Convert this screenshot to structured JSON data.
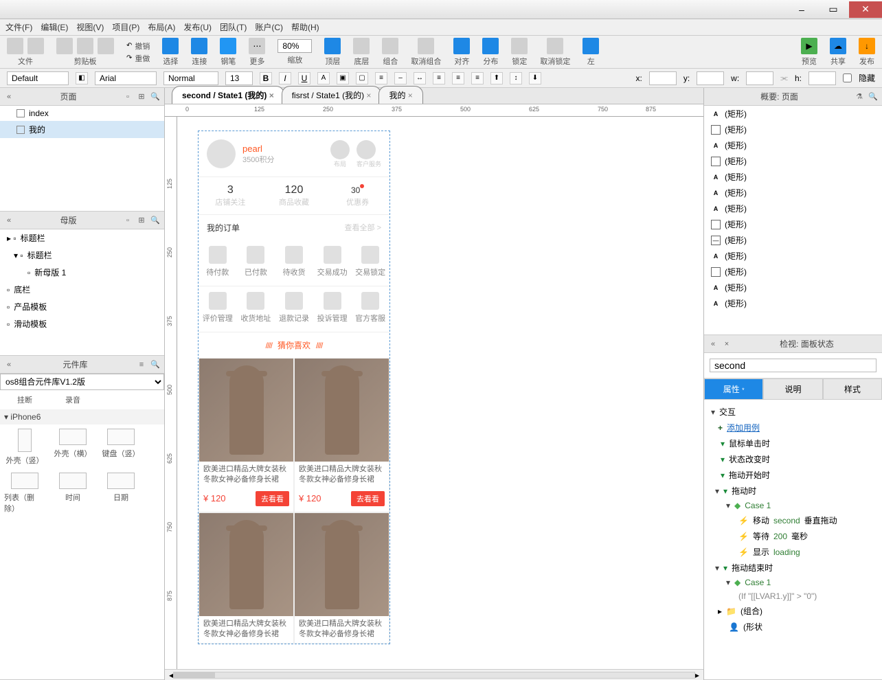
{
  "window": {
    "close": "✕",
    "max": "▭",
    "min": "–"
  },
  "menubar": [
    "文件(F)",
    "编辑(E)",
    "视图(V)",
    "项目(P)",
    "布局(A)",
    "发布(U)",
    "团队(T)",
    "账户(C)",
    "帮助(H)"
  ],
  "toolbar": {
    "file": "文件",
    "clipboard": "剪贴板",
    "undo": "撤销",
    "redo": "重做",
    "select": "选择",
    "connect": "连接",
    "pen": "钢笔",
    "more": "更多",
    "zoom_label": "缩放",
    "zoom": "80%",
    "front": "顶层",
    "back": "底层",
    "group": "组合",
    "ungroup": "取消组合",
    "align": "对齐",
    "distribute": "分布",
    "lock": "锁定",
    "unlock": "取消锁定",
    "left": "左",
    "preview": "预览",
    "share": "共享",
    "publish": "发布"
  },
  "formatbar": {
    "style": "Default",
    "font": "Arial",
    "weight": "Normal",
    "size": "13",
    "x": "x:",
    "y": "y:",
    "w": "w:",
    "h": "h:",
    "hidden": "隐藏"
  },
  "tabs": [
    {
      "label": "second / State1 (我的)",
      "active": true
    },
    {
      "label": "fisrst / State1 (我的)",
      "active": false
    },
    {
      "label": "我的",
      "active": false
    }
  ],
  "ruler_h": [
    "0",
    "125",
    "250",
    "375",
    "500",
    "625",
    "750",
    "875"
  ],
  "ruler_v": [
    "125",
    "250",
    "375",
    "500",
    "625",
    "750",
    "875"
  ],
  "pages_panel": {
    "title": "页面",
    "items": [
      {
        "label": "index",
        "sel": false
      },
      {
        "label": "我的",
        "sel": true
      }
    ]
  },
  "masters_panel": {
    "title": "母版",
    "items": [
      "标题栏",
      "标题栏",
      "新母版 1",
      "底栏",
      "产品模板",
      "滑动模板"
    ]
  },
  "widgets_panel": {
    "title": "元件库",
    "lib": "os8组合元件库V1.2版",
    "row1": [
      "挂断",
      "录音"
    ],
    "section": "iPhone6",
    "grid": [
      "外壳（竖）",
      "外壳（横）",
      "键盘（竖）",
      "列表（删除）",
      "时间",
      "日期"
    ]
  },
  "outline_panel": {
    "title": "概要: 页面",
    "items": [
      {
        "t": "A",
        "l": "(矩形)"
      },
      {
        "t": "box",
        "l": "(矩形)"
      },
      {
        "t": "A",
        "l": "(矩形)"
      },
      {
        "t": "box",
        "l": "(矩形)"
      },
      {
        "t": "A",
        "l": "(矩形)"
      },
      {
        "t": "A",
        "l": "(矩形)"
      },
      {
        "t": "A",
        "l": "(矩形)"
      },
      {
        "t": "box",
        "l": "(矩形)"
      },
      {
        "t": "line",
        "l": "(矩形)"
      },
      {
        "t": "A",
        "l": "(矩形)"
      },
      {
        "t": "box",
        "l": "(矩形)"
      },
      {
        "t": "A",
        "l": "(矩形)"
      },
      {
        "t": "A",
        "l": "(矩形)"
      }
    ]
  },
  "inspector": {
    "title": "检视: 面板状态",
    "name": "second",
    "tabs": [
      "属性",
      "说明",
      "样式"
    ],
    "interact": "交互",
    "add_case": "添加用例",
    "events": [
      "鼠标单击时",
      "状态改变时",
      "拖动开始时"
    ],
    "drag": "拖动时",
    "case1": "Case 1",
    "actions": [
      {
        "p": "移动 ",
        "g": "second",
        "s": " 垂直拖动"
      },
      {
        "p": "等待 ",
        "g": "200",
        "s": " 毫秒"
      },
      {
        "p": "显示 ",
        "g": "loading",
        "s": ""
      }
    ],
    "drag_end": "拖动结束时",
    "case1b": "Case 1",
    "cond": "(If \"[[LVAR1.y]]\" > \"0\")",
    "group": "(组合)",
    "shape": "(形状"
  },
  "mock": {
    "user": "pearl",
    "points": "3500积分",
    "msg": "布局",
    "svc": "客户服务",
    "stats": [
      {
        "n": "3",
        "l": "店铺关注"
      },
      {
        "n": "120",
        "l": "商品收藏"
      },
      {
        "n": "30",
        "l": "优惠券",
        "dot": true
      }
    ],
    "orders_title": "我的订单",
    "orders_more": "查看全部 >",
    "order_icons": [
      "待付款",
      "已付款",
      "待收货",
      "交易成功",
      "交易锁定"
    ],
    "svc_icons": [
      "评价管理",
      "收货地址",
      "退款记录",
      "投诉管理",
      "官方客服"
    ],
    "guess": "猜你喜欢",
    "slash": "////",
    "product": {
      "title": "欧美进口精品大牌女装秋冬款女神必备修身长裙",
      "price": "¥ 120",
      "btn": "去看看"
    }
  }
}
